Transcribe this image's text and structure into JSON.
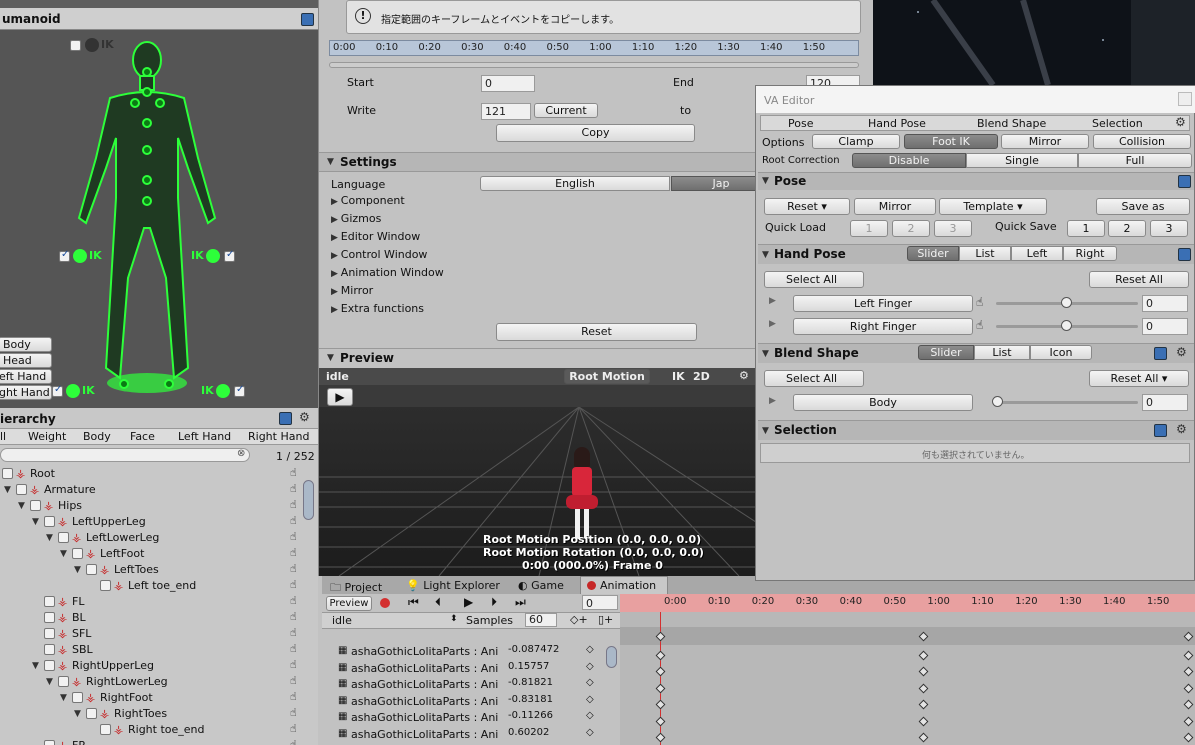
{
  "humanoid": {
    "title": "umanoid",
    "ik_head": "IK",
    "ik_left": "IK",
    "ik_right": "IK",
    "ik_foot_left": "IK",
    "ik_foot_right": "IK",
    "parts": [
      "Body",
      "Head",
      "eft Hand",
      "ght Hand"
    ]
  },
  "hierarchy": {
    "title": "ierarchy",
    "tabs": [
      "ll",
      "Weight",
      "Body",
      "Face",
      "Left Hand",
      "Right Hand"
    ],
    "count": "1 / 252",
    "rows": [
      {
        "label": "Root",
        "indent": 0
      },
      {
        "label": "Armature",
        "indent": 1
      },
      {
        "label": "Hips",
        "indent": 2
      },
      {
        "label": "LeftUpperLeg",
        "indent": 3
      },
      {
        "label": "LeftLowerLeg",
        "indent": 4
      },
      {
        "label": "LeftFoot",
        "indent": 5
      },
      {
        "label": "LeftToes",
        "indent": 6
      },
      {
        "label": "Left toe_end",
        "indent": 7
      },
      {
        "label": "FL",
        "indent": 3
      },
      {
        "label": "BL",
        "indent": 3
      },
      {
        "label": "SFL",
        "indent": 3
      },
      {
        "label": "SBL",
        "indent": 3
      },
      {
        "label": "RightUpperLeg",
        "indent": 3
      },
      {
        "label": "RightLowerLeg",
        "indent": 4
      },
      {
        "label": "RightFoot",
        "indent": 5
      },
      {
        "label": "RightToes",
        "indent": 6
      },
      {
        "label": "Right toe_end",
        "indent": 7
      },
      {
        "label": "FR",
        "indent": 3
      }
    ]
  },
  "copy_panel": {
    "info": "指定範囲のキーフレームとイベントをコピーします。",
    "timeline_ticks": [
      "0:00",
      "0:10",
      "0:20",
      "0:30",
      "0:40",
      "0:50",
      "1:00",
      "1:10",
      "1:20",
      "1:30",
      "1:40",
      "1:50"
    ],
    "start_label": "Start",
    "start_value": "0",
    "end_label": "End",
    "end_value": "120",
    "write_label": "Write",
    "write_value": "121",
    "current_button": "Current",
    "to_label": "to",
    "copy_button": "Copy"
  },
  "settings": {
    "title": "Settings",
    "language_label": "Language",
    "lang_english": "English",
    "lang_japanese": "Jap",
    "items": [
      "Component",
      "Gizmos",
      "Editor Window",
      "Control Window",
      "Animation Window",
      "Mirror",
      "Extra functions"
    ],
    "reset_button": "Reset"
  },
  "preview": {
    "title": "Preview",
    "clip": "idle",
    "root_motion": "Root Motion",
    "ik": "IK",
    "twod": "2D",
    "pos_text": "Root Motion Position (0.0, 0.0, 0.0)",
    "rot_text": "Root Motion Rotation (0.0, 0.0, 0.0)",
    "frame_text": "0:00 (000.0%) Frame 0"
  },
  "bottom_tabs": [
    "Project",
    "Light Explorer",
    "Game",
    "Animation"
  ],
  "animation": {
    "preview_label": "Preview",
    "frame": "0",
    "clip": "idle",
    "samples_label": "Samples",
    "samples_value": "60",
    "ticks": [
      "0:00",
      "0:10",
      "0:20",
      "0:30",
      "0:40",
      "0:50",
      "1:00",
      "1:10",
      "1:20",
      "1:30",
      "1:40",
      "1:50"
    ],
    "props": [
      {
        "name": "ashaGothicLolitaParts : Ani",
        "value": "-0.087472"
      },
      {
        "name": "ashaGothicLolitaParts : Ani",
        "value": "0.15757"
      },
      {
        "name": "ashaGothicLolitaParts : Ani",
        "value": "-0.81821"
      },
      {
        "name": "ashaGothicLolitaParts : Ani",
        "value": "-0.83181"
      },
      {
        "name": "ashaGothicLolitaParts : Ani",
        "value": "-0.11266"
      },
      {
        "name": "ashaGothicLolitaParts : Ani",
        "value": "0.60202"
      }
    ]
  },
  "va_editor": {
    "title": "VA Editor",
    "tabs": [
      "Pose",
      "Hand Pose",
      "Blend Shape",
      "Selection"
    ],
    "options_label": "Options",
    "options": [
      "Clamp",
      "Foot IK",
      "Mirror",
      "Collision"
    ],
    "root_correction_label": "Root Correction",
    "root_correction": [
      "Disable",
      "Single",
      "Full"
    ],
    "pose": {
      "title": "Pose",
      "reset": "Reset",
      "mirror": "Mirror",
      "template": "Template",
      "save_as": "Save as",
      "quick_load_label": "Quick Load",
      "quick_load": [
        "1",
        "2",
        "3"
      ],
      "quick_save_label": "Quick Save",
      "quick_save": [
        "1",
        "2",
        "3"
      ]
    },
    "hand_pose": {
      "title": "Hand Pose",
      "modes": [
        "Slider",
        "List",
        "Left",
        "Right"
      ],
      "select_all": "Select All",
      "reset_all": "Reset All",
      "left_finger": "Left Finger",
      "left_value": "0",
      "left_level": 0.5,
      "right_finger": "Right Finger",
      "right_value": "0",
      "right_level": 0.5
    },
    "blend_shape": {
      "title": "Blend Shape",
      "modes": [
        "Slider",
        "List",
        "Icon"
      ],
      "select_all": "Select All",
      "reset_all": "Reset All",
      "body": "Body",
      "body_value": "0"
    },
    "selection": {
      "title": "Selection",
      "empty": "何も選択されていません。"
    }
  }
}
